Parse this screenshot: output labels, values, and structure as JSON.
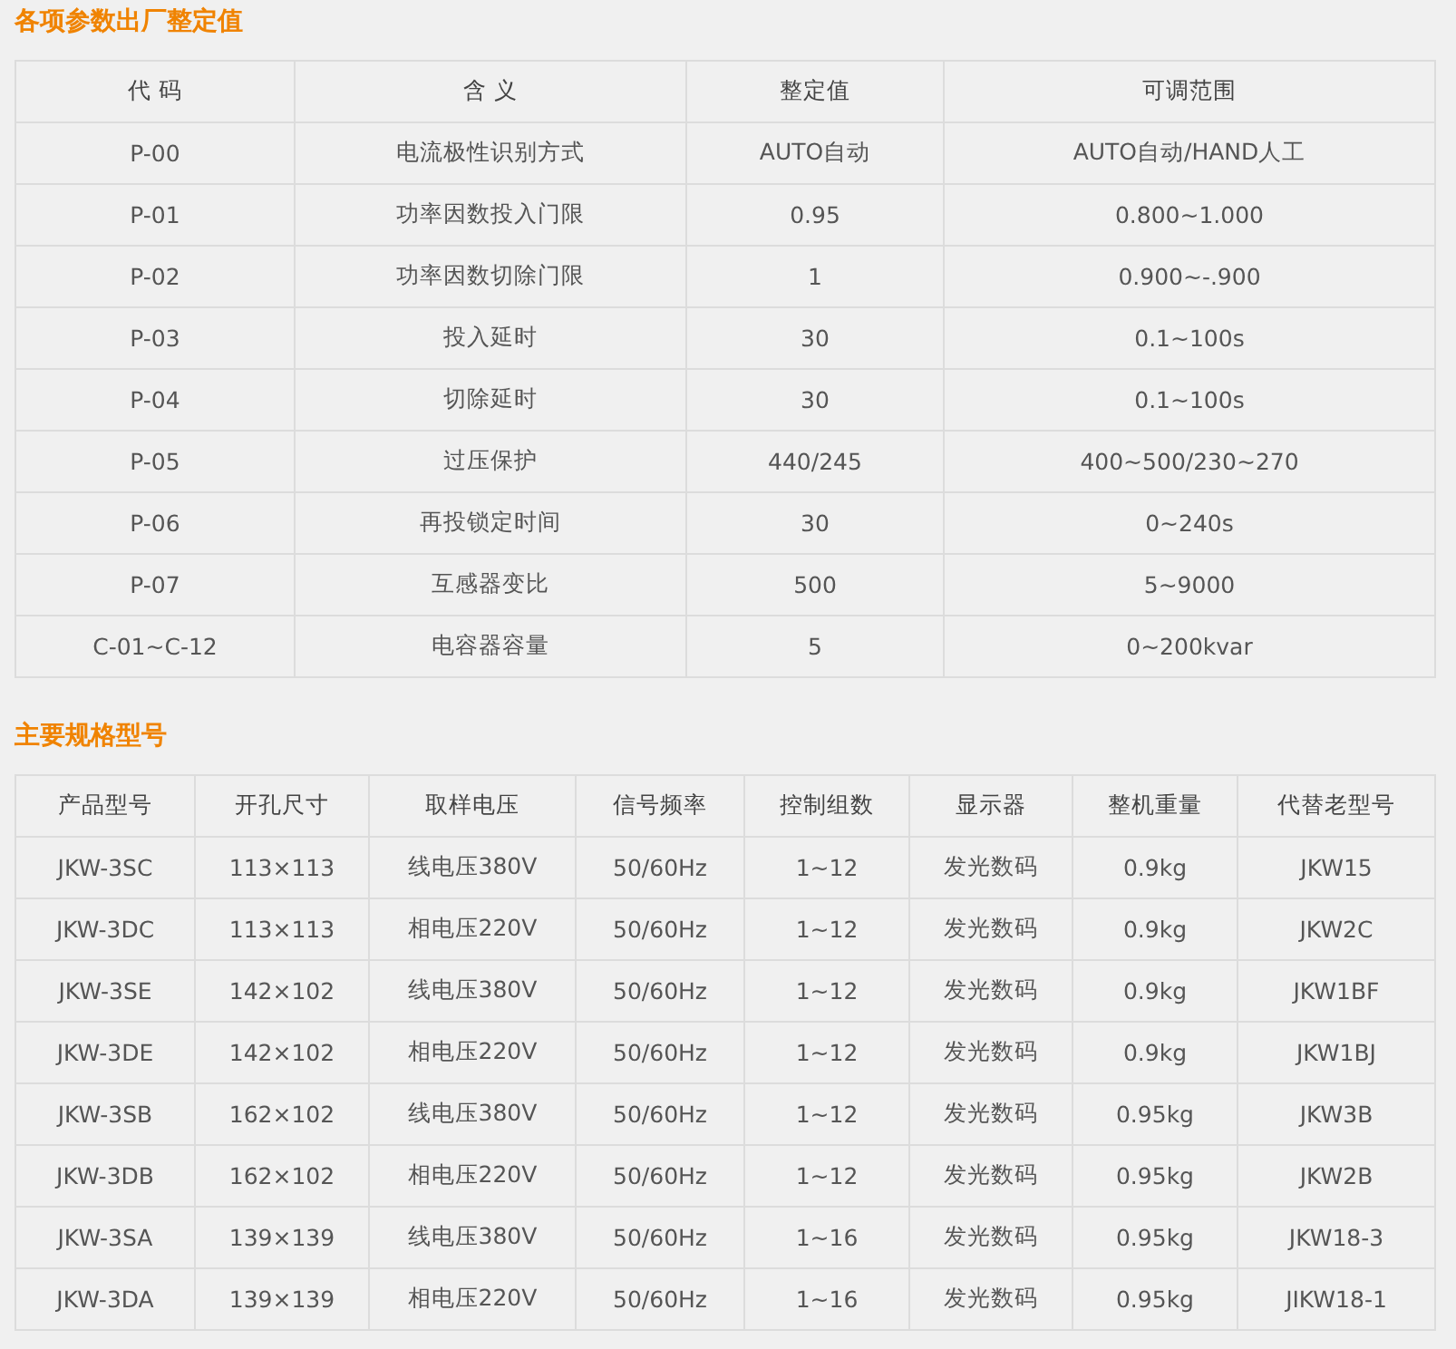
{
  "sections": [
    {
      "title": "各项参数出厂整定值",
      "table": {
        "columns": [
          "代 码",
          "含 义",
          "整定值",
          "可调范围"
        ],
        "rows": [
          [
            "P-00",
            "电流极性识别方式",
            "AUTO自动",
            "AUTO自动/HAND人工"
          ],
          [
            "P-01",
            "功率因数投入门限",
            "0.95",
            "0.800~1.000"
          ],
          [
            "P-02",
            "功率因数切除门限",
            "1",
            "0.900~-.900"
          ],
          [
            "P-03",
            "投入延时",
            "30",
            "0.1~100s"
          ],
          [
            "P-04",
            "切除延时",
            "30",
            "0.1~100s"
          ],
          [
            "P-05",
            "过压保护",
            "440/245",
            "400~500/230~270"
          ],
          [
            "P-06",
            "再投锁定时间",
            "30",
            "0~240s"
          ],
          [
            "P-07",
            "互感器变比",
            "500",
            "5~9000"
          ],
          [
            "C-01~C-12",
            "电容器容量",
            "5",
            "0~200kvar"
          ]
        ]
      }
    },
    {
      "title": "主要规格型号",
      "table": {
        "columns": [
          "产品型号",
          "开孔尺寸",
          "取样电压",
          "信号频率",
          "控制组数",
          "显示器",
          "整机重量",
          "代替老型号"
        ],
        "rows": [
          [
            "JKW-3SC",
            "113×113",
            "线电压380V",
            "50/60Hz",
            "1~12",
            "发光数码",
            "0.9kg",
            "JKW15"
          ],
          [
            "JKW-3DC",
            "113×113",
            "相电压220V",
            "50/60Hz",
            "1~12",
            "发光数码",
            "0.9kg",
            "JKW2C"
          ],
          [
            "JKW-3SE",
            "142×102",
            "线电压380V",
            "50/60Hz",
            "1~12",
            "发光数码",
            "0.9kg",
            "JKW1BF"
          ],
          [
            "JKW-3DE",
            "142×102",
            "相电压220V",
            "50/60Hz",
            "1~12",
            "发光数码",
            "0.9kg",
            "JKW1BJ"
          ],
          [
            "JKW-3SB",
            "162×102",
            "线电压380V",
            "50/60Hz",
            "1~12",
            "发光数码",
            "0.95kg",
            "JKW3B"
          ],
          [
            "JKW-3DB",
            "162×102",
            "相电压220V",
            "50/60Hz",
            "1~12",
            "发光数码",
            "0.95kg",
            "JKW2B"
          ],
          [
            "JKW-3SA",
            "139×139",
            "线电压380V",
            "50/60Hz",
            "1~16",
            "发光数码",
            "0.95kg",
            "JKW18-3"
          ],
          [
            "JKW-3DA",
            "139×139",
            "相电压220V",
            "50/60Hz",
            "1~16",
            "发光数码",
            "0.95kg",
            "JIKW18-1"
          ]
        ]
      }
    }
  ]
}
